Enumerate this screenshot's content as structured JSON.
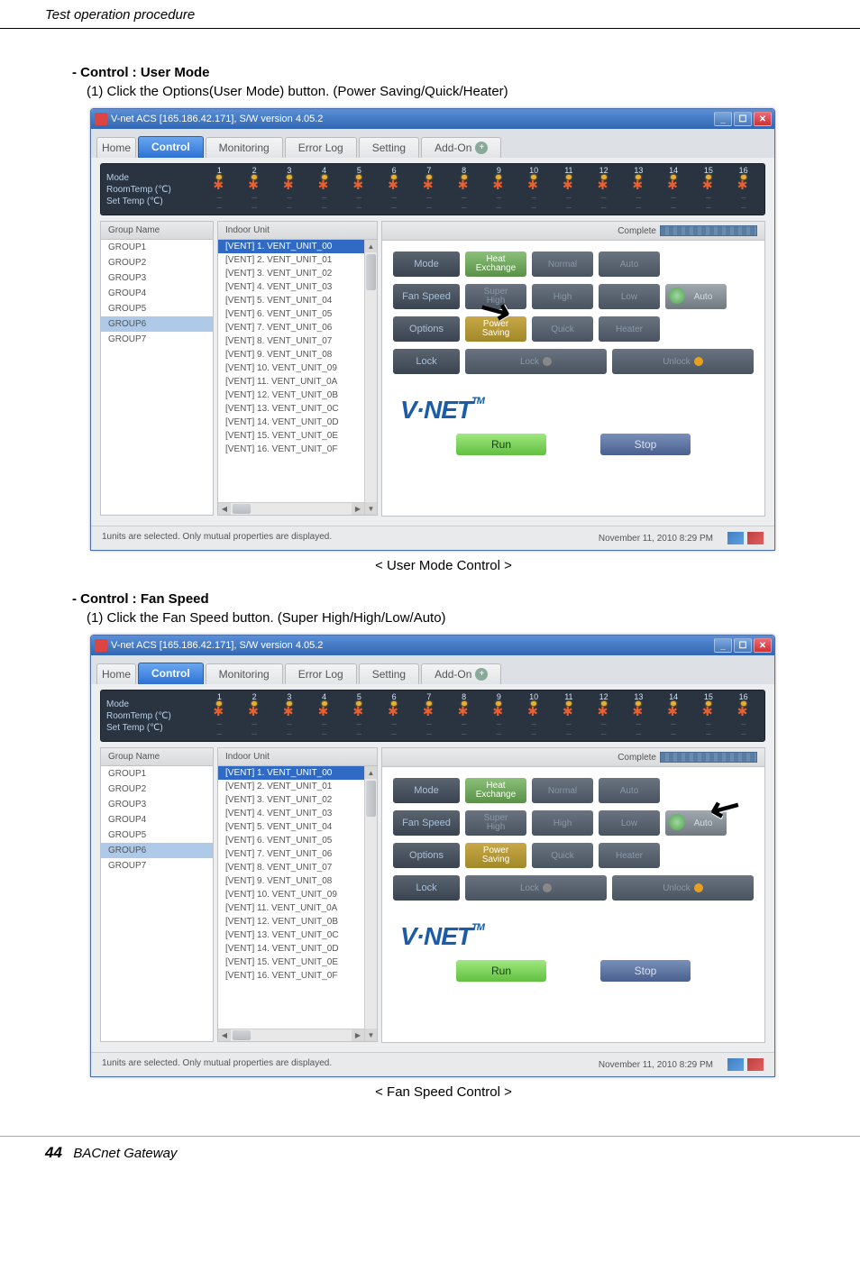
{
  "page": {
    "header": "Test operation procedure",
    "footer_num": "44",
    "footer_text": "BACnet Gateway"
  },
  "section1": {
    "title": "- Control : User Mode",
    "desc": "(1) Click the Options(User Mode) button. (Power Saving/Quick/Heater)",
    "caption": "< User Mode Control >"
  },
  "section2": {
    "title": "- Control : Fan Speed",
    "desc": "(1) Click the Fan Speed button. (Super High/High/Low/Auto)",
    "caption": "< Fan Speed Control >"
  },
  "app": {
    "title": "V-net ACS [165.186.42.171],   S/W version 4.05.2",
    "tabs": {
      "home": "Home",
      "control": "Control",
      "monitoring": "Monitoring",
      "errorlog": "Error Log",
      "setting": "Setting",
      "addon": "Add-On"
    },
    "strip": {
      "mode": "Mode",
      "roomtemp": "RoomTemp (℃)",
      "settemp": "Set Temp   (℃)"
    },
    "panel_headers": {
      "group": "Group Name",
      "indoor": "Indoor Unit",
      "complete": "Complete"
    },
    "groups": [
      "GROUP1",
      "GROUP2",
      "GROUP3",
      "GROUP4",
      "GROUP5",
      "GROUP6",
      "GROUP7"
    ],
    "selected_group": "GROUP6",
    "units": [
      "[VENT] 1. VENT_UNIT_00",
      "[VENT] 2. VENT_UNIT_01",
      "[VENT] 3. VENT_UNIT_02",
      "[VENT] 4. VENT_UNIT_03",
      "[VENT] 5. VENT_UNIT_04",
      "[VENT] 6. VENT_UNIT_05",
      "[VENT] 7. VENT_UNIT_06",
      "[VENT] 8. VENT_UNIT_07",
      "[VENT] 9. VENT_UNIT_08",
      "[VENT] 10. VENT_UNIT_09",
      "[VENT] 11. VENT_UNIT_0A",
      "[VENT] 12. VENT_UNIT_0B",
      "[VENT] 13. VENT_UNIT_0C",
      "[VENT] 14. VENT_UNIT_0D",
      "[VENT] 15. VENT_UNIT_0E",
      "[VENT] 16. VENT_UNIT_0F"
    ],
    "controls": {
      "mode": {
        "label": "Mode",
        "buttons": [
          "Heat\nExchange",
          "Normal",
          "Auto"
        ]
      },
      "fan": {
        "label": "Fan Speed",
        "buttons": [
          "Super\nHigh",
          "High",
          "Low",
          "Auto"
        ]
      },
      "options": {
        "label": "Options",
        "buttons": [
          "Power\nSaving",
          "Quick",
          "Heater"
        ]
      },
      "lock": {
        "label": "Lock",
        "buttons": [
          "Lock",
          "Unlock"
        ]
      }
    },
    "logo": "V·NET",
    "tm": "TM",
    "run": "Run",
    "stop": "Stop",
    "status": "1units are selected. Only mutual properties are displayed.",
    "timestamp": "November 11, 2010  8:29 PM"
  }
}
